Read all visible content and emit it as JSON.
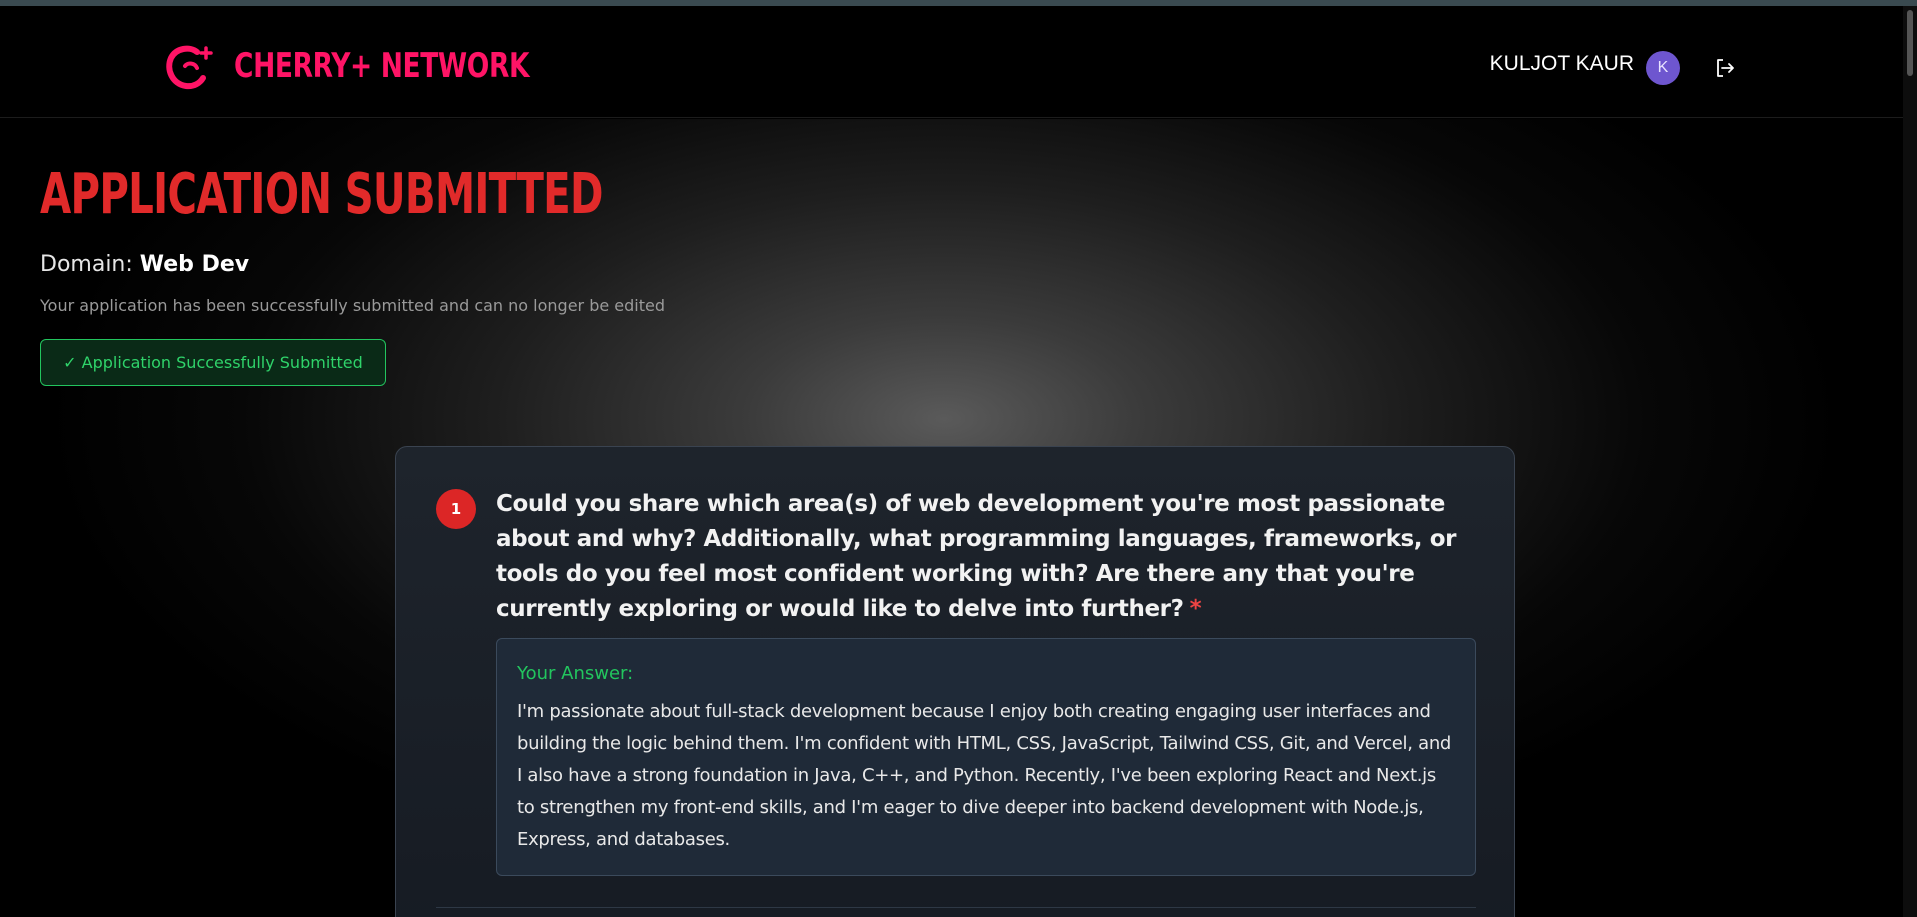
{
  "header": {
    "brand": "CHERRY+ NETWORK",
    "user_name": "KULJOT KAUR",
    "avatar_initial": "K"
  },
  "page": {
    "title": "APPLICATION SUBMITTED",
    "domain_label": "Domain:",
    "domain_value": "Web Dev",
    "subtitle": "Your application has been successfully submitted and can no longer be edited",
    "status_badge": "✓ Application Successfully Submitted"
  },
  "questions": [
    {
      "number": "1",
      "text": "Could you share which area(s) of web development you're most passionate about and why? Additionally, what programming languages, frameworks, or tools do you feel most confident working with? Are there any that you're currently exploring or would like to delve into further?",
      "required_mark": "*",
      "answer_label": "Your Answer:",
      "answer": "I'm passionate about full-stack development because I enjoy both creating engaging user interfaces and building the logic behind them. I'm confident with HTML, CSS, JavaScript, Tailwind CSS, Git, and Vercel, and I also have a strong foundation in Java, C++, and Python. Recently, I've been exploring React and Next.js to strengthen my front-end skills, and I'm eager to dive deeper into backend development with Node.js, Express, and databases."
    }
  ],
  "colors": {
    "brand": "#ff1466",
    "title": "#e12a2a",
    "success": "#22c55e",
    "avatar": "#6e56cf"
  }
}
